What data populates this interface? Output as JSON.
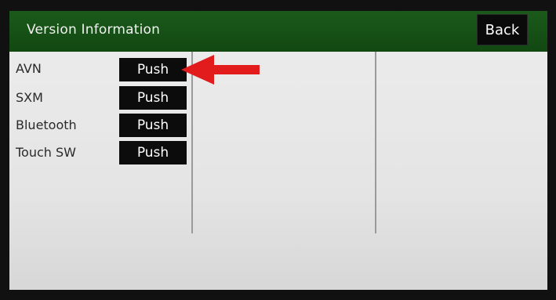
{
  "header": {
    "title": "Version Information",
    "back_label": "Back"
  },
  "rows": [
    {
      "label": "AVN",
      "button": "Push"
    },
    {
      "label": "SXM",
      "button": "Push"
    },
    {
      "label": "Bluetooth",
      "button": "Push"
    },
    {
      "label": "Touch SW",
      "button": "Push"
    }
  ],
  "annotation": {
    "icon": "red-arrow-icon",
    "color": "#e21c1c"
  },
  "colors": {
    "header_green": "#1b5a1b",
    "button_black": "#0c0c0c",
    "screen_bg": "#e9e9e9"
  }
}
